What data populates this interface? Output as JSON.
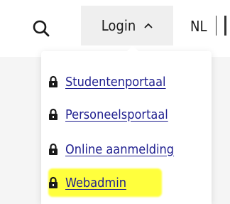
{
  "header": {
    "search_icon": "search-icon",
    "login_label": "Login",
    "login_caret_icon": "chevron-up-icon",
    "language_current": "NL"
  },
  "dropdown": {
    "items": [
      {
        "label": "Studentenportaal",
        "icon": "lock-icon"
      },
      {
        "label": "Personeelsportaal",
        "icon": "lock-icon"
      },
      {
        "label": "Online aanmelding",
        "icon": "lock-icon"
      },
      {
        "label": "Webadmin",
        "icon": "lock-icon",
        "highlighted": true
      }
    ]
  },
  "colors": {
    "link": "#1f1f8f",
    "highlight": "#ffff3d",
    "login_button_bg": "#efefef",
    "page_bg": "#f5f5f5"
  }
}
